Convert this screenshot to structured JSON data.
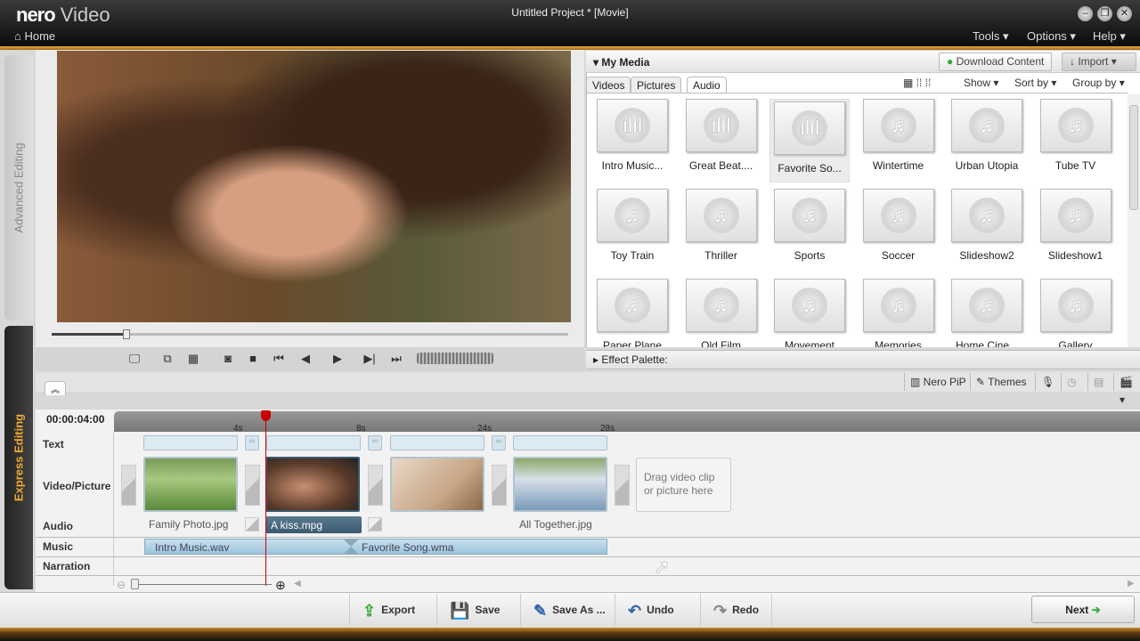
{
  "app": {
    "brand": "nero",
    "product": "Video",
    "title": "Untitled Project * [Movie]",
    "home": "Home",
    "menus": [
      "Tools ▾",
      "Options ▾",
      "Help ▾"
    ],
    "window_buttons": [
      "minimize-icon",
      "restore-icon",
      "close-icon"
    ]
  },
  "sidebar": {
    "advanced": "Advanced Editing",
    "express": "Express Editing",
    "accent": "#f0a830"
  },
  "preview": {
    "scrub_progress": 0.14
  },
  "media": {
    "title": "My Media",
    "download": "Download Content",
    "import": "Import",
    "tabs": [
      "Videos",
      "Pictures",
      "Audio"
    ],
    "active_tab": "Audio",
    "show": "Show",
    "sortby": "Sort by",
    "groupby": "Group by",
    "items": [
      {
        "label": "Intro Music...",
        "icon": "waveform"
      },
      {
        "label": "Great Beat....",
        "icon": "waveform"
      },
      {
        "label": "Favorite So...",
        "icon": "waveform",
        "selected": true
      },
      {
        "label": "Wintertime",
        "icon": "note"
      },
      {
        "label": "Urban Utopia",
        "icon": "note"
      },
      {
        "label": "Tube TV",
        "icon": "note"
      },
      {
        "label": "Toy Train",
        "icon": "note"
      },
      {
        "label": "Thriller",
        "icon": "note"
      },
      {
        "label": "Sports",
        "icon": "note"
      },
      {
        "label": "Soccer",
        "icon": "note"
      },
      {
        "label": "Slideshow2",
        "icon": "note"
      },
      {
        "label": "Slideshow1",
        "icon": "note"
      },
      {
        "label": "Paper Plane",
        "icon": "note"
      },
      {
        "label": "Old Film",
        "icon": "note"
      },
      {
        "label": "Movement",
        "icon": "note"
      },
      {
        "label": "Memories",
        "icon": "note"
      },
      {
        "label": "Home Cine...",
        "icon": "note"
      },
      {
        "label": "Gallery",
        "icon": "note"
      }
    ]
  },
  "effect_palette": "Effect Palette:",
  "toolbar2": {
    "pip": "Nero PiP",
    "themes": "Themes"
  },
  "timeline": {
    "timecode": "00:00:04:00",
    "ticks": [
      "4s",
      "8s",
      "24s",
      "28s"
    ],
    "rows": {
      "text": "Text",
      "video": "Video/Picture",
      "audio": "Audio",
      "music": "Music",
      "narration": "Narration"
    },
    "clips": [
      "Family Photo.jpg",
      "A kiss.mpg",
      "",
      "All Together.jpg"
    ],
    "drop_hint": "Drag video clip or picture here",
    "music": [
      "Intro Music.wav",
      "Favorite Song.wma"
    ]
  },
  "bottom": {
    "export": "Export",
    "save": "Save",
    "saveas": "Save As ...",
    "undo": "Undo",
    "redo": "Redo",
    "next": "Next"
  }
}
